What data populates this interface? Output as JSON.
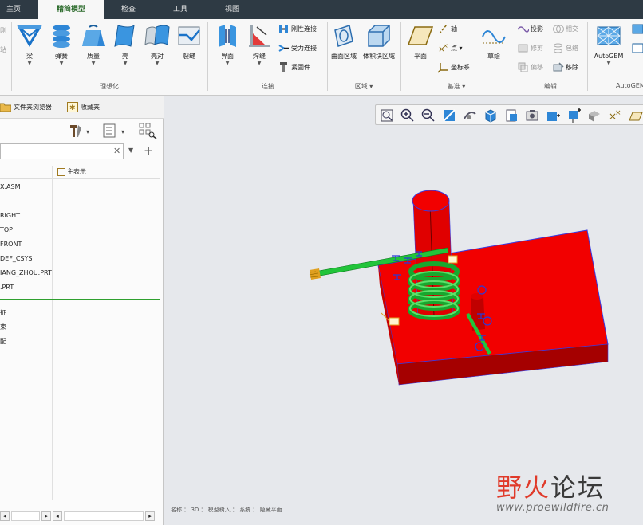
{
  "tabs": [
    {
      "label": "主页",
      "active": false
    },
    {
      "label": "精简模型",
      "active": true
    },
    {
      "label": "检查",
      "active": false
    },
    {
      "label": "工具",
      "active": false
    },
    {
      "label": "视图",
      "active": false
    }
  ],
  "ribbon": {
    "cut_left": [
      "刚",
      "站"
    ],
    "idealize": {
      "group_label": "理想化",
      "items": [
        {
          "label": "梁",
          "icon": "beam-icon"
        },
        {
          "label": "弹簧",
          "icon": "spring-icon"
        },
        {
          "label": "质量",
          "icon": "mass-icon"
        },
        {
          "label": "壳",
          "icon": "shell-icon"
        },
        {
          "label": "壳对",
          "icon": "shell-pair-icon"
        },
        {
          "label": "裂缝",
          "icon": "crack-icon"
        }
      ]
    },
    "connect": {
      "group_label": "连接",
      "items": [
        {
          "label": "界面",
          "icon": "interface-icon"
        },
        {
          "label": "焊缝",
          "icon": "weld-icon"
        }
      ],
      "small": [
        {
          "label": "刚性连接",
          "icon": "rigid-link-icon"
        },
        {
          "label": "受力连接",
          "icon": "weighted-link-icon"
        },
        {
          "label": "紧固件",
          "icon": "fastener-icon"
        }
      ]
    },
    "region": {
      "group_label": "区域",
      "items": [
        {
          "label": "曲面区域",
          "icon": "surface-region-icon"
        },
        {
          "label": "体积块区域",
          "icon": "volume-region-icon"
        }
      ]
    },
    "datum": {
      "group_label": "基准",
      "items": [
        {
          "label": "平面",
          "icon": "plane-icon"
        },
        {
          "label": "草绘",
          "icon": "sketch-icon"
        }
      ],
      "small": [
        {
          "label": "轴",
          "icon": "axis-icon"
        },
        {
          "label": "点",
          "icon": "point-icon"
        },
        {
          "label": "坐标系",
          "icon": "csys-icon"
        }
      ]
    },
    "edit": {
      "group_label": "编辑",
      "small": [
        {
          "label": "投影",
          "icon": "project-icon"
        },
        {
          "label": "相交",
          "icon": "intersect-icon"
        },
        {
          "label": "修剪",
          "icon": "trim-icon"
        },
        {
          "label": "包络",
          "icon": "wrap-icon"
        },
        {
          "label": "偏移",
          "icon": "offset-icon"
        },
        {
          "label": "移除",
          "icon": "remove-icon"
        }
      ]
    },
    "autogem": {
      "group_label": "AutoGEM",
      "label": "AutoGEM",
      "icon": "autogem-mesh-icon"
    }
  },
  "panel": {
    "tabs": [
      {
        "label": "文件夹浏览器",
        "icon": "folder-icon"
      },
      {
        "label": "收藏夹",
        "icon": "favorites-icon"
      }
    ],
    "search": {
      "value": ""
    },
    "column_header": "主表示",
    "tree": [
      "X.ASM",
      "RIGHT",
      "TOP",
      "FRONT",
      "DEF_CSYS",
      "IANG_ZHOU.PRT",
      ".PRT",
      "征",
      "束",
      "配"
    ]
  },
  "viewport": {
    "status_text": "名称 ： 3D ： 模型树入 ： 系统 ： 隐藏平面",
    "colors": {
      "body": "#f20000",
      "spring": "#22c43a",
      "edges": "#3a3ae0",
      "background": "#e6e8ec"
    }
  },
  "watermark": {
    "text_part1": "野火",
    "text_part2": "论坛",
    "url": "www.proewildfire.cn"
  }
}
